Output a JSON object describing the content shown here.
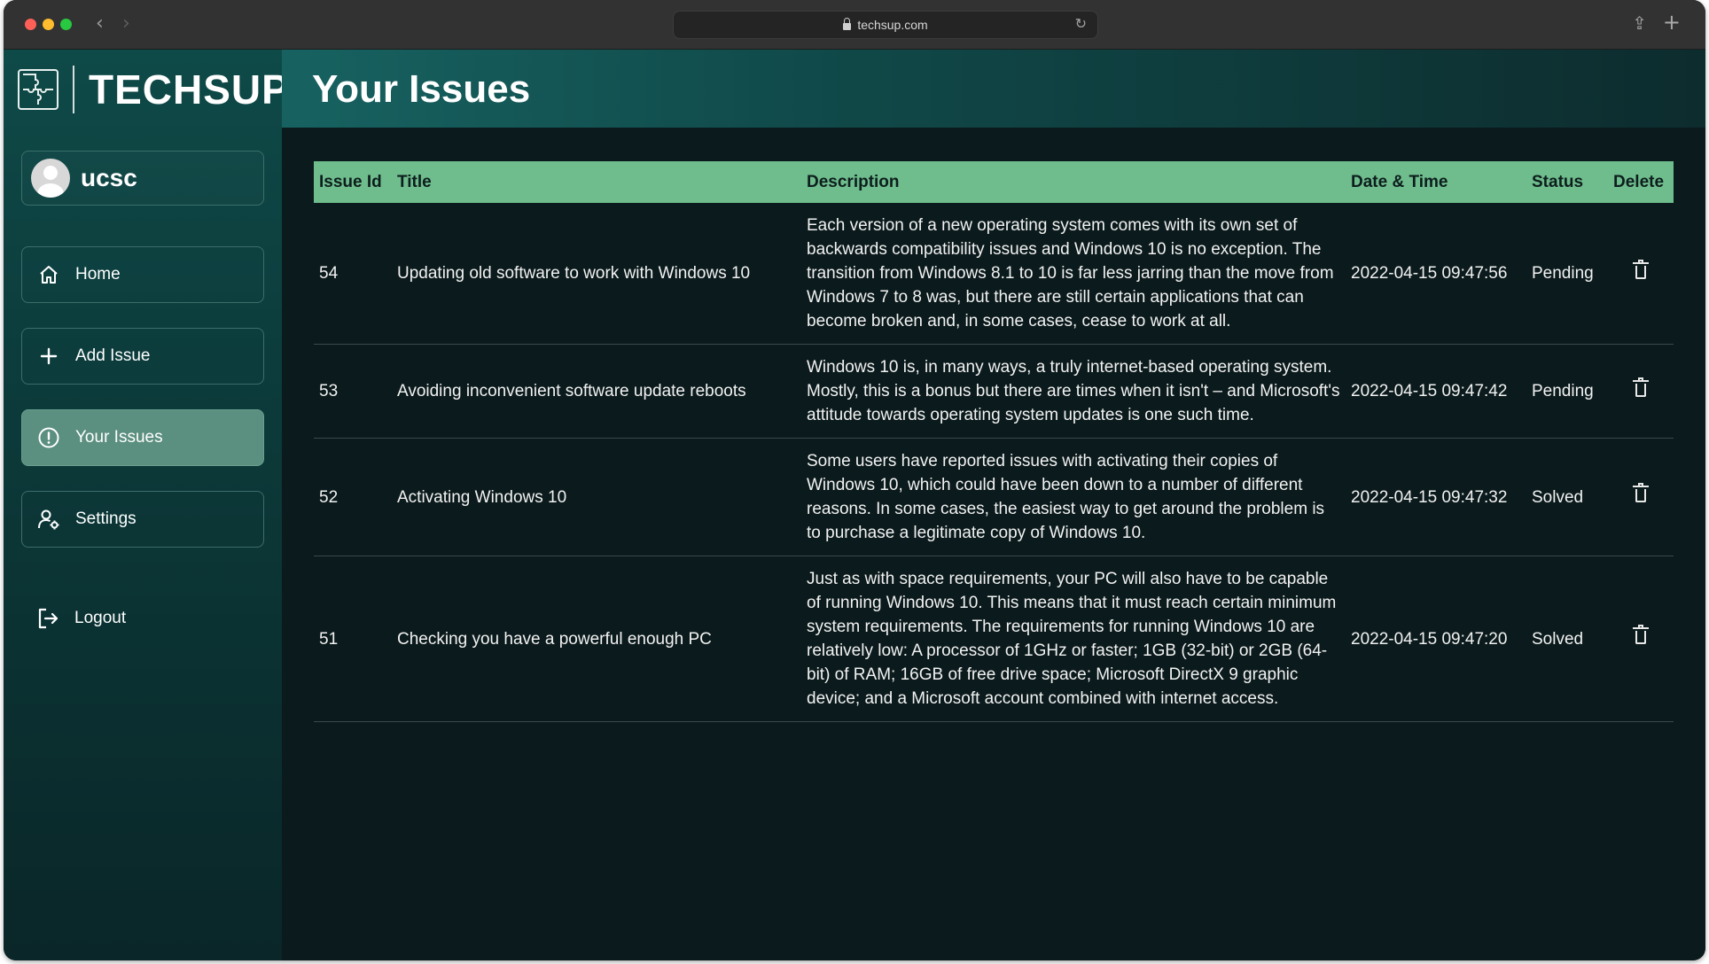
{
  "browser": {
    "url": "techsup.com"
  },
  "brand": {
    "name": "TECHSUP"
  },
  "user": {
    "name": "ucsc"
  },
  "sidebar": {
    "items": [
      {
        "label": "Home",
        "icon": "home-icon"
      },
      {
        "label": "Add Issue",
        "icon": "plus-icon"
      },
      {
        "label": "Your Issues",
        "icon": "alert-circle-icon",
        "active": true
      },
      {
        "label": "Settings",
        "icon": "user-settings-icon"
      },
      {
        "label": "Logout",
        "icon": "logout-icon"
      }
    ]
  },
  "page": {
    "title": "Your Issues"
  },
  "table": {
    "headers": {
      "id": "Issue Id",
      "title": "Title",
      "description": "Description",
      "datetime": "Date & Time",
      "status": "Status",
      "delete": "Delete"
    },
    "rows": [
      {
        "id": "54",
        "title": "Updating old software to work with Windows 10",
        "description": "Each version of a new operating system comes with its own set of backwards compatibility issues and Windows 10 is no exception. The transition from Windows 8.1 to 10 is far less jarring than the move from Windows 7 to 8 was, but there are still certain applications that can become broken and, in some cases, cease to work at all.",
        "datetime": "2022-04-15 09:47:56",
        "status": "Pending"
      },
      {
        "id": "53",
        "title": "Avoiding inconvenient software update reboots",
        "description": "Windows 10 is, in many ways, a truly internet-based operating system. Mostly, this is a bonus but there are times when it isn't – and Microsoft's attitude towards operating system updates is one such time.",
        "datetime": "2022-04-15 09:47:42",
        "status": "Pending"
      },
      {
        "id": "52",
        "title": "Activating Windows 10",
        "description": "Some users have reported issues with activating their copies of Windows 10, which could have been down to a number of different reasons. In some cases, the easiest way to get around the problem is to purchase a legitimate copy of Windows 10.",
        "datetime": "2022-04-15 09:47:32",
        "status": "Solved"
      },
      {
        "id": "51",
        "title": "Checking you have a powerful enough PC",
        "description": "Just as with space requirements, your PC will also have to be capable of running Windows 10. This means that it must reach certain minimum system requirements. The requirements for running Windows 10 are relatively low: A processor of 1GHz or faster; 1GB (32-bit) or 2GB (64-bit) of RAM; 16GB of free drive space; Microsoft DirectX 9 graphic device; and a Microsoft account combined with internet access.",
        "datetime": "2022-04-15 09:47:20",
        "status": "Solved"
      }
    ]
  },
  "colors": {
    "accent": "#6fbd8c",
    "sidebar_active": "#5b8f7f",
    "background": "#0b1a1c"
  }
}
